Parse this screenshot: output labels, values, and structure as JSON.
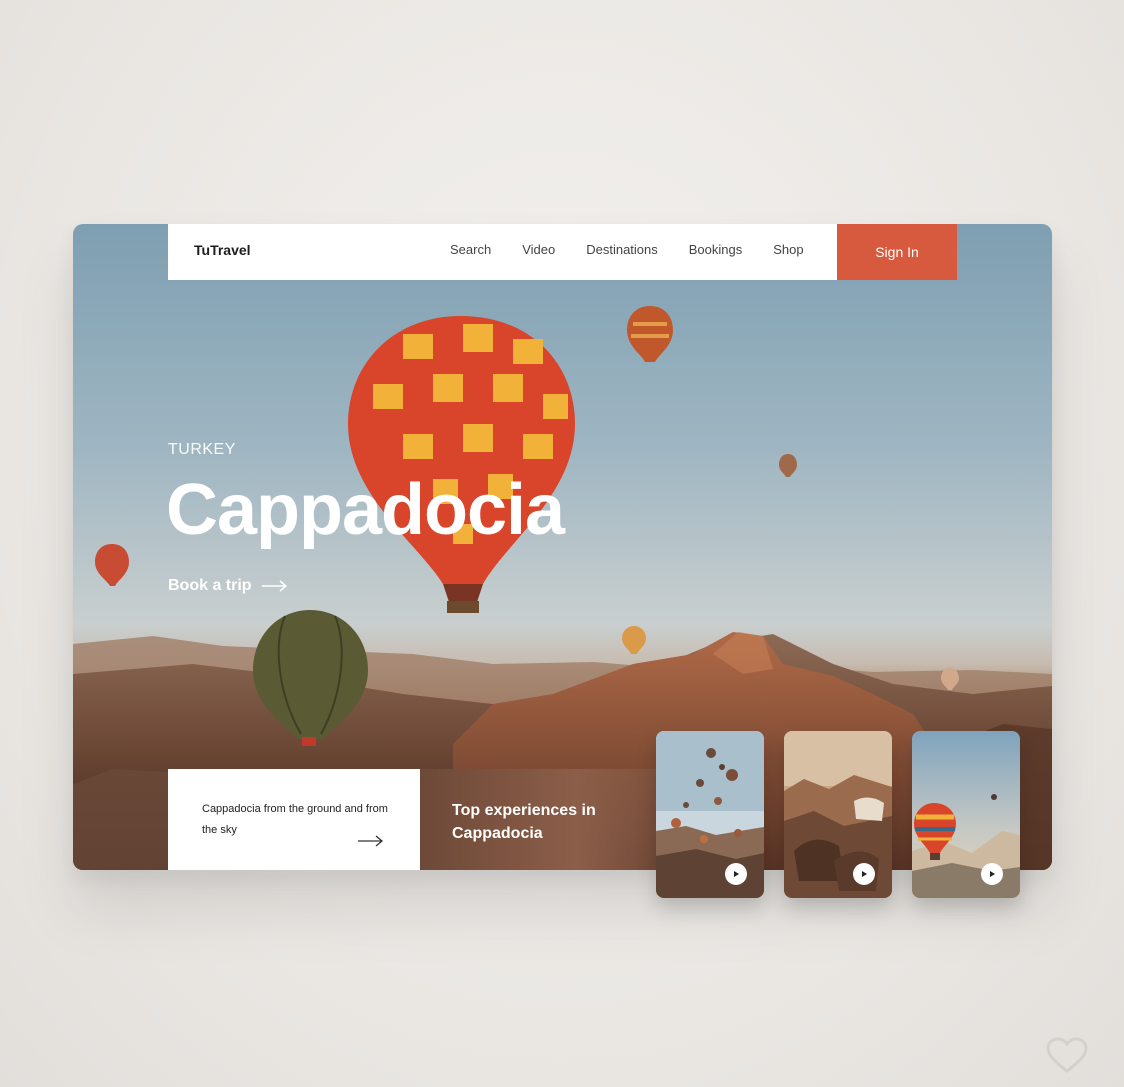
{
  "brand": {
    "name": "TuTravel"
  },
  "nav": {
    "items": [
      {
        "label": "Search"
      },
      {
        "label": "Video"
      },
      {
        "label": "Destinations"
      },
      {
        "label": "Bookings"
      },
      {
        "label": "Shop"
      }
    ],
    "signin_label": "Sign In"
  },
  "hero": {
    "eyebrow": "TURKEY",
    "title": "Cappadocia",
    "cta_label": "Book a trip"
  },
  "info_card": {
    "text": "Cappadocia from the ground and from the sky"
  },
  "experiences": {
    "title": "Top experiences in Cappadocia"
  },
  "thumbnails": [
    {
      "icon": "play-icon"
    },
    {
      "icon": "play-icon"
    },
    {
      "icon": "play-icon"
    }
  ],
  "colors": {
    "accent": "#d85a3e",
    "experiences_bg": "#7a5240",
    "sky": "#8fadbe"
  }
}
